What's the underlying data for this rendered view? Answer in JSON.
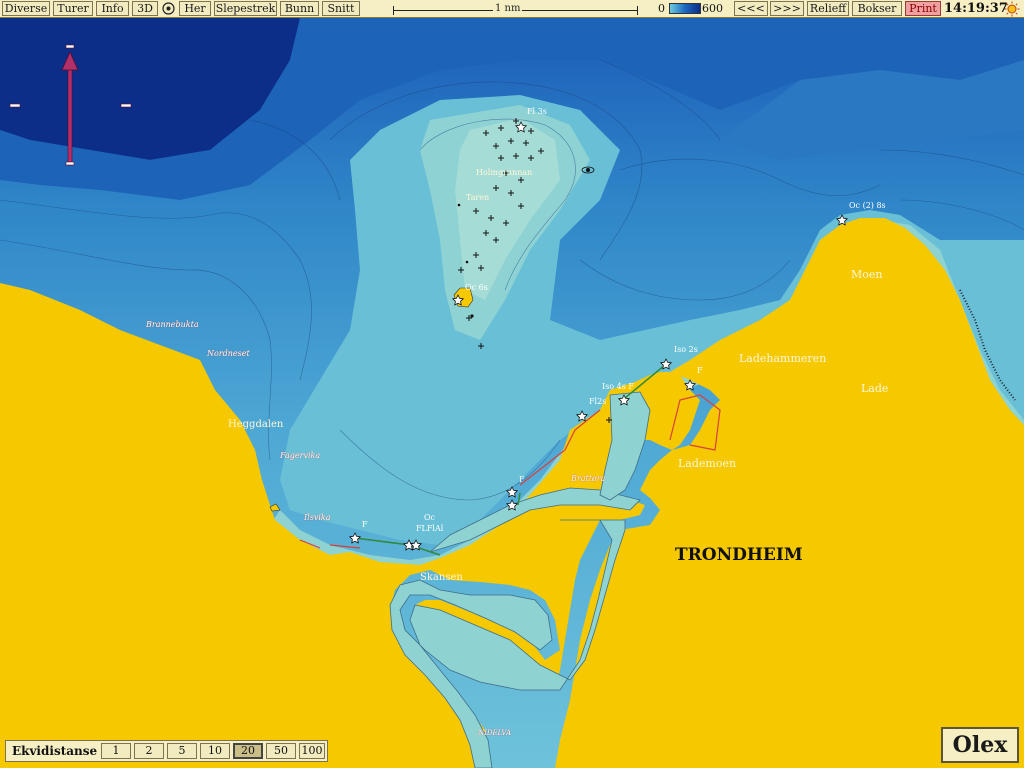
{
  "toolbar": {
    "menu": [
      "Diverse",
      "Turer",
      "Info",
      "3D"
    ],
    "here": "Her",
    "tools": [
      "Slepestrek",
      "Bunn",
      "Snitt"
    ],
    "scale_label": "1 nm",
    "depth_min": "0",
    "depth_max": "600",
    "nav": [
      "<<<",
      ">>>",
      "Relieff",
      "Bokser"
    ],
    "print": "Print",
    "clock": "14:19:37"
  },
  "map": {
    "places": {
      "holmgrunnan": "Holmgrunnan",
      "taren": "Taren",
      "brannebukta": "Brannebukta",
      "nordneset": "Nordneset",
      "heggdalen": "Heggdalen",
      "fagervika": "Fagervika",
      "ilsvika": "Ilsvika",
      "skansen": "Skansen",
      "trondheim": "TRONDHEIM",
      "brattora": "Brattøra",
      "lademoen": "Lademoen",
      "ladehammeren": "Ladehammeren",
      "lade": "Lade",
      "moen": "Moen",
      "nidelva": "NIDELVA"
    },
    "lights": {
      "fl3s": "Fl 3s",
      "oc6s": "Oc 6s",
      "oc2_8s": "Oc (2) 8s",
      "iso2s": "Iso 2s",
      "f_lade": "F",
      "iso4s_f": "Iso 4s F",
      "fl2s": "Fl2s",
      "f_brattora": "F",
      "f_ilsvika": "F",
      "oc": "Oc",
      "flfl": "FLFlAl"
    }
  },
  "ekvidistanse": {
    "label": "Ekvidistanse",
    "options": [
      "1",
      "2",
      "5",
      "10",
      "20",
      "50",
      "100"
    ],
    "selected": "20"
  },
  "logo": "Olex",
  "colors": {
    "land": "#e9b800",
    "toolbar": "#f6efc4",
    "shallow": "#8dd0d0",
    "deep": "#0c2e88"
  }
}
